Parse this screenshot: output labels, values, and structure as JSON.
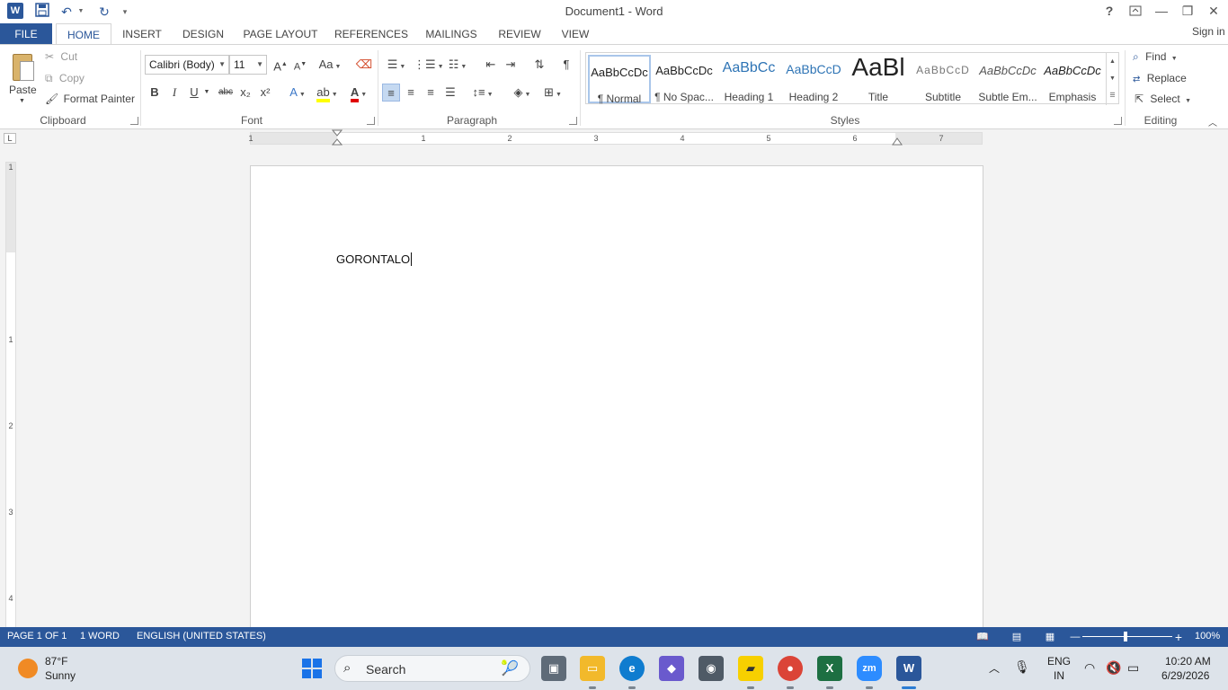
{
  "titlebar": {
    "app_letter": "W",
    "title": "Document1 - Word",
    "help": "?",
    "ribbon_options_icon": "ribbon-display-options-icon",
    "minimize": "—",
    "restore": "❐",
    "close": "✕"
  },
  "tabs": {
    "file": "FILE",
    "home": "HOME",
    "insert": "INSERT",
    "design": "DESIGN",
    "page_layout": "PAGE LAYOUT",
    "references": "REFERENCES",
    "mailings": "MAILINGS",
    "review": "REVIEW",
    "view": "VIEW",
    "sign_in": "Sign in"
  },
  "clipboard": {
    "paste": "Paste",
    "cut": "Cut",
    "copy": "Copy",
    "format_painter": "Format Painter",
    "group_label": "Clipboard"
  },
  "font": {
    "family": "Calibri (Body)",
    "size": "11",
    "group_label": "Font",
    "bold": "B",
    "italic": "I",
    "underline": "U",
    "strikethrough": "abc",
    "subscript": "x₂",
    "superscript": "x²"
  },
  "paragraph": {
    "group_label": "Paragraph"
  },
  "styles": {
    "group_label": "Styles",
    "items": [
      {
        "sample": "AaBbCcDc",
        "name": "¶ Normal"
      },
      {
        "sample": "AaBbCcDc",
        "name": "¶ No Spac..."
      },
      {
        "sample": "AaBbCc",
        "name": "Heading 1"
      },
      {
        "sample": "AaBbCcD",
        "name": "Heading 2"
      },
      {
        "sample": "AaBl",
        "name": "Title"
      },
      {
        "sample": "AaBbCcD",
        "name": "Subtitle"
      },
      {
        "sample": "AaBbCcDc",
        "name": "Subtle Em..."
      },
      {
        "sample": "AaBbCcDc",
        "name": "Emphasis"
      }
    ]
  },
  "editing": {
    "find": "Find",
    "replace": "Replace",
    "select": "Select",
    "group_label": "Editing"
  },
  "ruler": {
    "numbers": [
      "1",
      "1",
      "2",
      "3",
      "4",
      "5",
      "6",
      "7"
    ],
    "vnumbers": [
      "1",
      "1",
      "2",
      "3",
      "4"
    ]
  },
  "document": {
    "text": "GORONTALO"
  },
  "statusbar": {
    "page": "PAGE 1 OF 1",
    "words": "1 WORD",
    "language": "ENGLISH (UNITED STATES)",
    "zoom_out": "—",
    "zoom_in": "+",
    "zoom": "100%"
  },
  "taskbar": {
    "temperature": "87°F",
    "condition": "Sunny",
    "search": "Search",
    "language_top": "ENG",
    "language_bottom": "IN",
    "time": "10:20 AM",
    "date": "6/29/2026"
  },
  "colors": {
    "word_blue": "#2b579a",
    "statusbar": "#2b579a",
    "taskbar": "#dde3ea"
  }
}
